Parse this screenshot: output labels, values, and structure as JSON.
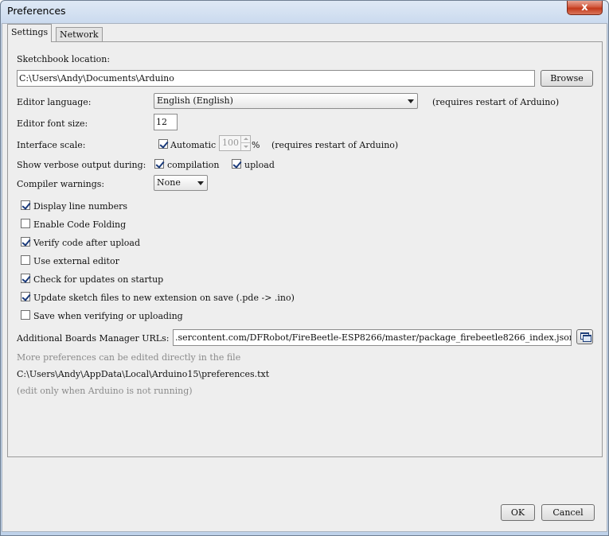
{
  "window": {
    "title": "Preferences",
    "close_glyph": "x"
  },
  "tabs": [
    {
      "label": "Settings",
      "active": true
    },
    {
      "label": "Network",
      "active": false
    }
  ],
  "sketchbook": {
    "label": "Sketchbook location:",
    "value": "C:\\Users\\Andy\\Documents\\Arduino",
    "browse_label": "Browse"
  },
  "editor_language": {
    "label": "Editor language:",
    "value": "English (English)",
    "note": "(requires restart of Arduino)"
  },
  "editor_font_size": {
    "label": "Editor font size:",
    "value": "12"
  },
  "interface_scale": {
    "label": "Interface scale:",
    "automatic_label": "Automatic",
    "automatic_checked": true,
    "value": "100",
    "unit": "%",
    "note": "(requires restart of Arduino)"
  },
  "verbose": {
    "label": "Show verbose output during:",
    "compilation_label": "compilation",
    "compilation_checked": true,
    "upload_label": "upload",
    "upload_checked": true
  },
  "compiler_warnings": {
    "label": "Compiler warnings:",
    "value": "None"
  },
  "options": [
    {
      "label": "Display line numbers",
      "checked": true
    },
    {
      "label": "Enable Code Folding",
      "checked": false
    },
    {
      "label": "Verify code after upload",
      "checked": true
    },
    {
      "label": "Use external editor",
      "checked": false
    },
    {
      "label": "Check for updates on startup",
      "checked": true
    },
    {
      "label": "Update sketch files to new extension on save (.pde -> .ino)",
      "checked": true
    },
    {
      "label": "Save when verifying or uploading",
      "checked": false
    }
  ],
  "boards_manager": {
    "label": "Additional Boards Manager URLs:",
    "value": ".sercontent.com/DFRobot/FireBeetle-ESP8266/master/package_firebeetle8266_index.json",
    "icon": "window-stack-icon"
  },
  "footer_info": {
    "more_prefs": "More preferences can be edited directly in the file",
    "prefs_path": "C:\\Users\\Andy\\AppData\\Local\\Arduino15\\preferences.txt",
    "edit_note": "(edit only when Arduino is not running)"
  },
  "buttons": {
    "ok_label": "OK",
    "cancel_label": "Cancel"
  }
}
